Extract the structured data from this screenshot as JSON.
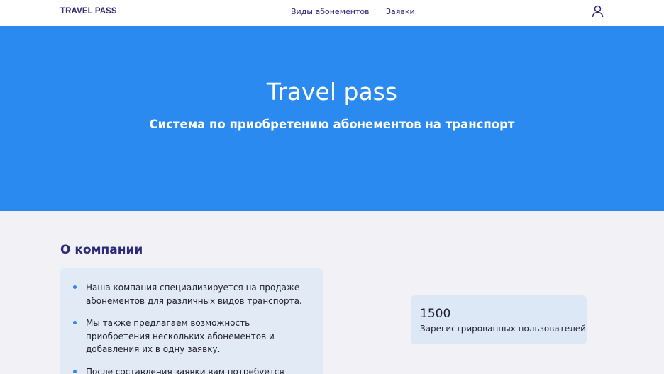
{
  "header": {
    "logo": "TRAVEL PASS",
    "nav": [
      {
        "label": "Виды абонементов"
      },
      {
        "label": "Заявки"
      }
    ],
    "user_icon": "user-icon"
  },
  "hero": {
    "title": "Travel pass",
    "subtitle": "Система по приобретению абонементов на транспорт"
  },
  "about": {
    "title": "О компании",
    "items": [
      {
        "text": "Наша компания специализируется на продаже абонементов для различных видов транспорта."
      },
      {
        "text": "Мы также предлагаем возможность приобретения нескольких абонементов и добавления их в одну заявку."
      },
      {
        "text": "После составления заявки вам потребуется"
      }
    ]
  },
  "stats": {
    "count": "1500",
    "label": "Зарегистрированных пользователей"
  },
  "colors": {
    "accent": "#2b8af0",
    "brand_text": "#2e2a7a",
    "page_background": "#f1f1f6",
    "card_background": "#e1eaf5"
  }
}
